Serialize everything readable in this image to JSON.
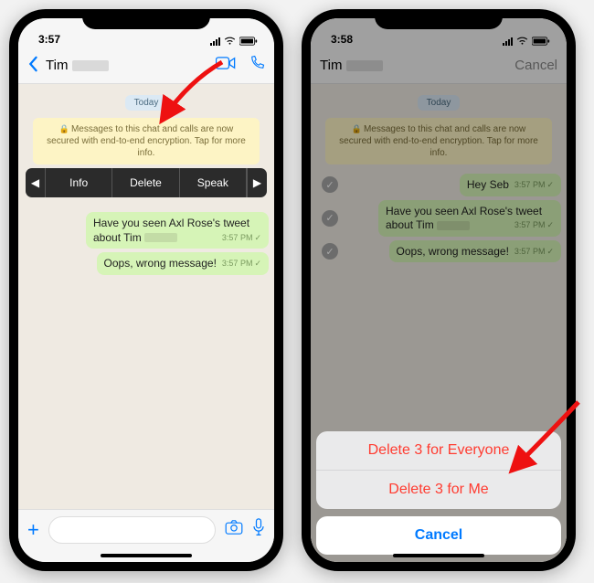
{
  "status": {
    "time": "3:57",
    "time2": "3:58"
  },
  "header": {
    "contact": "Tim",
    "cancel": "Cancel"
  },
  "chat": {
    "date": "Today",
    "encryption": "Messages to this chat and calls are now secured with end-to-end encryption. Tap for more info.",
    "msg1": "Hey Seb",
    "msg2a": "Have you seen Axl Rose's tweet about Tim",
    "msg3": "Oops, wrong message!",
    "time1": "3:57 PM",
    "time2": "3:57 PM",
    "time3": "3:57 PM"
  },
  "context_menu": {
    "info": "Info",
    "delete": "Delete",
    "speak": "Speak"
  },
  "action_sheet": {
    "del_everyone": "Delete 3 for Everyone",
    "del_me": "Delete 3 for Me",
    "cancel": "Cancel"
  }
}
